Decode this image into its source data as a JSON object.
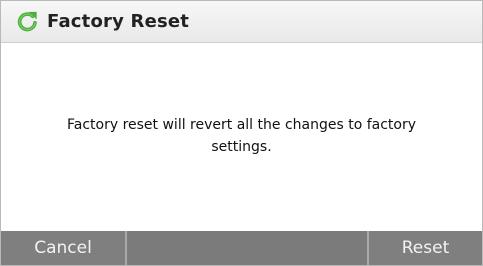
{
  "dialog": {
    "title": "Factory Reset",
    "title_icon": "reset-arrow-icon",
    "message": "Factory reset will revert all the changes to factory settings.",
    "buttons": {
      "cancel": "Cancel",
      "reset": "Reset"
    }
  },
  "colors": {
    "titlebar": "#eeeeee",
    "button_bar": "#7f7f7f",
    "button_text": "#f3f3f3",
    "icon_green": "#58b947"
  }
}
